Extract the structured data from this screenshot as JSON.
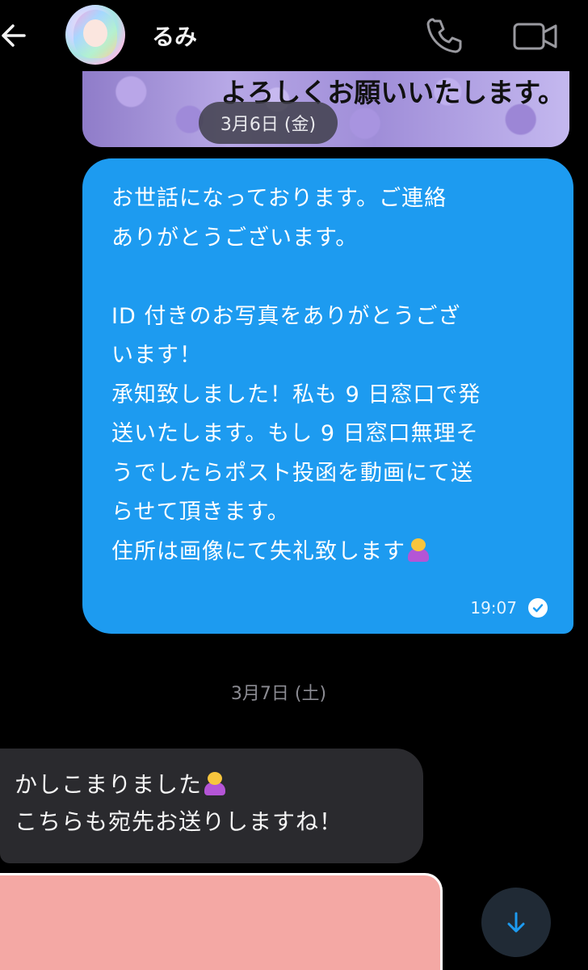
{
  "header": {
    "contact_name": "るみ"
  },
  "image_message": {
    "caption": "よろしくお願いいたします。"
  },
  "date_separators": [
    "3月6日 (金)",
    "3月7日 (土)"
  ],
  "sent_message": {
    "text": "お世話になっております。ご連絡\nありがとうございます。\n\nID 付きのお写真をありがとうござ\nいます！\n承知致しました！私も 9 日窓口で発\n送いたします。もし 9 日窓口無理そ\nうでしたらポスト投函を動画にて送\nらせて頂きます。\n住所は画像にて失礼致します",
    "emoji": "bowing-woman-emoji",
    "time": "19:07",
    "status": "read-check-icon"
  },
  "received_message": {
    "line1": "かしこまりました",
    "emoji": "bowing-woman-emoji",
    "line2": "こちらも宛先お送りしますね！"
  },
  "colors": {
    "sent_bubble": "#1d9bf0",
    "received_bubble": "#2a2a2e",
    "background": "#000000",
    "pink_image": "#f4a8a4"
  },
  "icons": {
    "back": "back-arrow-icon",
    "call": "phone-icon",
    "video": "video-camera-icon",
    "scroll": "arrow-down-icon"
  }
}
